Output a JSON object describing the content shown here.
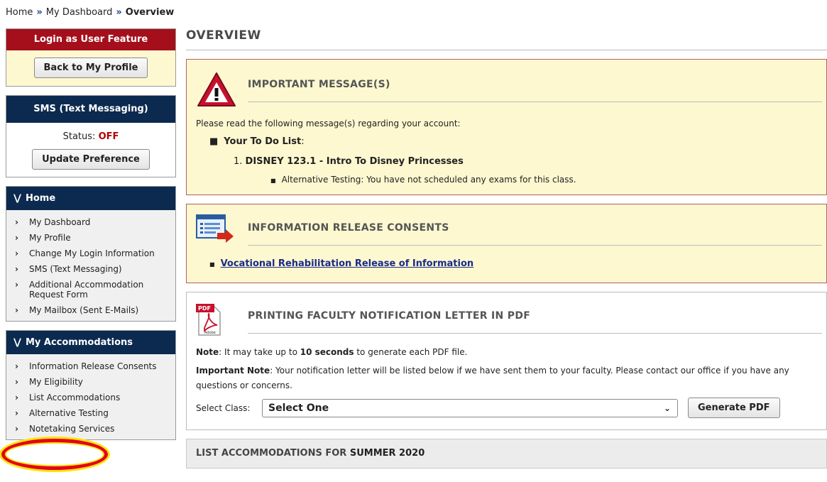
{
  "breadcrumb": {
    "home": "Home",
    "dashboard": "My Dashboard",
    "current": "Overview",
    "separator": "»"
  },
  "sidebar": {
    "login_box": {
      "title": "Login as User Feature",
      "button": "Back to My Profile"
    },
    "sms_box": {
      "title": "SMS (Text Messaging)",
      "status_label": "Status:",
      "status_value": "OFF",
      "button": "Update Preference"
    },
    "home_section": {
      "title": "Home",
      "items": [
        "My Dashboard",
        "My Profile",
        "Change My Login Information",
        "SMS (Text Messaging)",
        "Additional Accommodation Request Form",
        "My Mailbox (Sent E-Mails)"
      ]
    },
    "accommodations_section": {
      "title": "My Accommodations",
      "items": [
        "Information Release Consents",
        "My Eligibility",
        "List Accommodations",
        "Alternative Testing",
        "Notetaking Services"
      ]
    }
  },
  "main": {
    "title": "OVERVIEW",
    "important": {
      "title": "IMPORTANT MESSAGE(S)",
      "intro": "Please read the following message(s) regarding your account:",
      "todo_label": "Your To Do List",
      "class_number": "1.",
      "class_name": "DISNEY 123.1 - Intro To Disney Princesses",
      "note": "Alternative Testing: You have not scheduled any exams for this class."
    },
    "consents": {
      "title": "INFORMATION RELEASE CONSENTS",
      "link": "Vocational Rehabilitation Release of Information"
    },
    "pdf": {
      "title": "PRINTING FACULTY NOTIFICATION LETTER IN PDF",
      "note_label": "Note",
      "note_pre": ": It may take up to ",
      "note_strong": "10 seconds",
      "note_post": " to generate each PDF file.",
      "important_label": "Important Note",
      "important_line1": ": Your notification letter will be listed below if we have sent them to your faculty. Please contact our office if you have any",
      "important_line2": "questions or concerns.",
      "select_label": "Select Class:",
      "select_value": "Select One",
      "button": "Generate PDF",
      "icon_text": "PDF",
      "icon_sub": "Adobe"
    },
    "list_accommodations": {
      "prefix": "LIST ACCOMMODATIONS FOR ",
      "term": "SUMMER 2020"
    }
  }
}
